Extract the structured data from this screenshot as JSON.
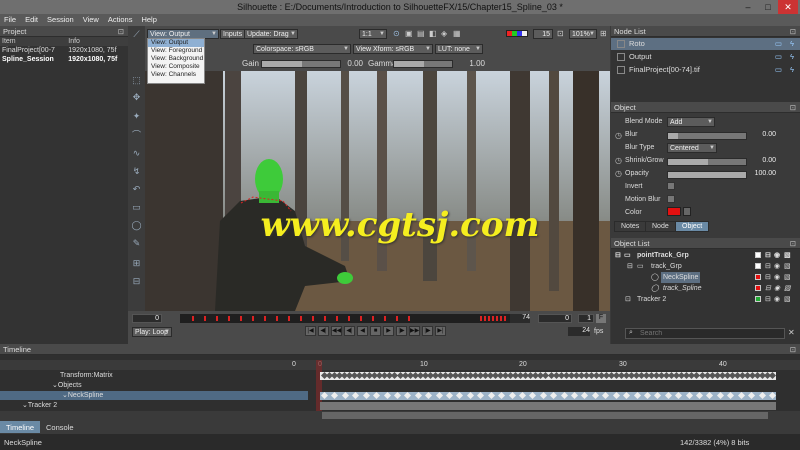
{
  "window": {
    "title": "Silhouette : E:/Documents/Introduction to SilhouetteFX/15/Chapter15_Spline_03 *",
    "minimize": "–",
    "maximize": "□",
    "close": "✕"
  },
  "menu": [
    "File",
    "Edit",
    "Session",
    "View",
    "Actions",
    "Help"
  ],
  "project": {
    "header": "Project",
    "columns": [
      "Item",
      "Info"
    ],
    "rows": [
      {
        "item": "FinalProject[00-7",
        "info": "1920x1080, 75f"
      },
      {
        "item": "Spline_Session",
        "info": "1920x1080, 75f"
      }
    ]
  },
  "viewer": {
    "view_select": "View: Output",
    "inputs": "Inputs",
    "update": "Update: Drag",
    "ratio": "1:1",
    "frame_count": "15",
    "zoom": "101%",
    "colorspace": "Colorspace: sRGB",
    "view_xform": "View Xform: sRGB",
    "lut": "LUT: none",
    "gain_label": "Gain",
    "gain_value": "0.00",
    "gamma_label": "Gamma",
    "gamma_value": "1.00",
    "view_menu": [
      "View: Output",
      "View: Foreground",
      "View: Background",
      "View: Composite",
      "View: Channels"
    ]
  },
  "playback": {
    "start": "0",
    "current": "74",
    "in": "0",
    "step": "1",
    "f_label": "F",
    "play_mode": "Play: Loop",
    "fps": "24",
    "fps_label": "fps"
  },
  "node_list": {
    "header": "Node List",
    "nodes": [
      "Roto",
      "Output",
      "FinalProject[00-74].tif"
    ]
  },
  "object_props": {
    "header": "Object",
    "blend_mode_label": "Blend Mode",
    "blend_mode": "Add",
    "blur_label": "Blur",
    "blur_value": "0.00",
    "blur_type_label": "Blur Type",
    "blur_type": "Centered",
    "shrink_label": "Shrink/Grow",
    "shrink_value": "0.00",
    "opacity_label": "Opacity",
    "opacity_value": "100.00",
    "invert_label": "Invert",
    "motion_blur_label": "Motion Blur",
    "color_label": "Color",
    "color": "#e41010",
    "tabs": [
      "Notes",
      "Node",
      "Object"
    ]
  },
  "object_list": {
    "header": "Object List",
    "items": [
      {
        "name": "pointTrack_Grp",
        "color": "#ffffff"
      },
      {
        "name": "track_Grp",
        "color": "#ffffff"
      },
      {
        "name": "NeckSpline",
        "color": "#e41010"
      },
      {
        "name": "track_Spline",
        "color": "#e41010"
      },
      {
        "name": "Tracker 2",
        "color": "#22aa33"
      }
    ],
    "search_placeholder": "Search"
  },
  "timeline": {
    "header": "Timeline",
    "frame_zero": "0",
    "ticks": [
      "0",
      "10",
      "20",
      "30",
      "40"
    ],
    "rows": [
      "Transform:Matrix",
      "Objects",
      "NeckSpline",
      "Tracker 2"
    ]
  },
  "bottom_tabs": [
    "Timeline",
    "Console"
  ],
  "status": {
    "selection": "NeckSpline",
    "memory": "142/3382 (4%) 8 bits"
  },
  "watermark": "www.cgtsj.com"
}
